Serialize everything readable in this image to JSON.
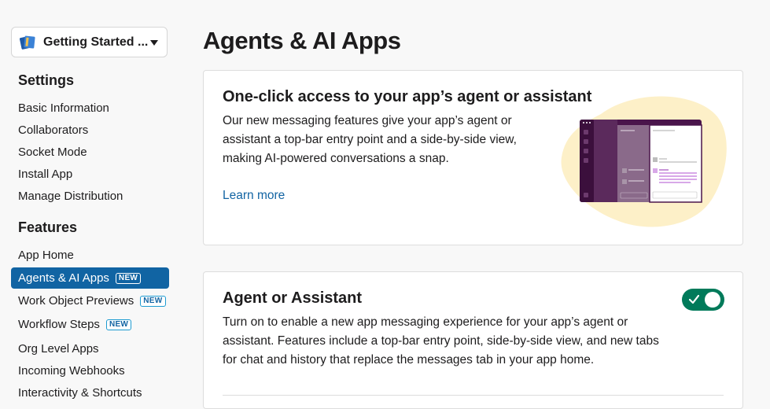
{
  "workspace": {
    "name": "Getting Started ...",
    "icon": "notebook-icon"
  },
  "sidebar": {
    "settings_heading": "Settings",
    "settings_items": [
      {
        "label": "Basic Information"
      },
      {
        "label": "Collaborators"
      },
      {
        "label": "Socket Mode"
      },
      {
        "label": "Install App"
      },
      {
        "label": "Manage Distribution"
      }
    ],
    "features_heading": "Features",
    "features_items": [
      {
        "label": "App Home"
      },
      {
        "label": "Agents & AI Apps",
        "badge": "NEW",
        "active": true
      },
      {
        "label": "Work Object Previews",
        "badge": "NEW"
      },
      {
        "label": "Workflow Steps",
        "badge": "NEW"
      },
      {
        "label": "Org Level Apps"
      },
      {
        "label": "Incoming Webhooks"
      },
      {
        "label": "Interactivity & Shortcuts"
      }
    ]
  },
  "main": {
    "title": "Agents & AI Apps",
    "promo_card": {
      "title": "One-click access to your app’s agent or assistant",
      "body_lines": [
        "Our new messaging features give your app’s agent or",
        "assistant a top-bar entry point and a side-by-side view,",
        "making AI-powered conversations a snap."
      ],
      "link": "Learn more"
    },
    "agent_card": {
      "title": "Agent or Assistant",
      "toggle_on": true,
      "body_lines": [
        "Turn on to enable a new app messaging experience for your app’s agent or",
        "assistant. Features include a top-bar entry point, side-by-side view, and new tabs",
        "for chat and history that replace the messages tab in your app home."
      ]
    }
  },
  "colors": {
    "active_nav": "#1164a3",
    "link": "#1264a3",
    "toggle_on": "#007a5a",
    "badge_border": "#1d9bd1"
  }
}
